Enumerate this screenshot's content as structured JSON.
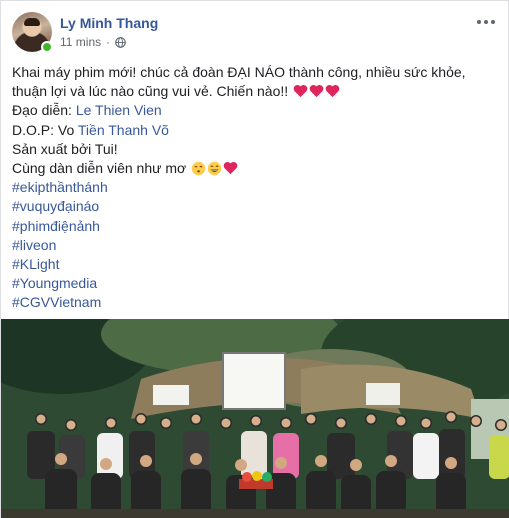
{
  "post": {
    "author_name": "Ly Minh Thang",
    "timestamp": "11 mins",
    "separator": "·",
    "privacy_icon": "globe-icon",
    "more_icon": "more-options-icon"
  },
  "body": {
    "line1": "Khai máy phim mới! chúc cả đoàn ĐẠI NÁO thành công, nhiều sức khỏe,",
    "line2": "thuận lợi và lúc nào cũng vui vẻ. Chiến nào!!",
    "director_prefix": "Đạo diễn: ",
    "director_link": "Le Thien Vien",
    "dop_prefix": "D.O.P: Vo ",
    "dop_link": "Tiền Thanh Võ",
    "producer": "Sản xuất bởi Tui!",
    "cast": "Cùng dàn diễn viên như mơ",
    "hashtags": [
      "#ekipthầnthánh",
      "#vuquyđạináo",
      "#phimđiệnảnh",
      "#liveon",
      "#KLight",
      "#Youngmedia",
      "#CGVVietnam"
    ]
  },
  "colors": {
    "link": "#385898",
    "author": "#365899",
    "heart": "#e0245e",
    "online": "#42b72a"
  }
}
